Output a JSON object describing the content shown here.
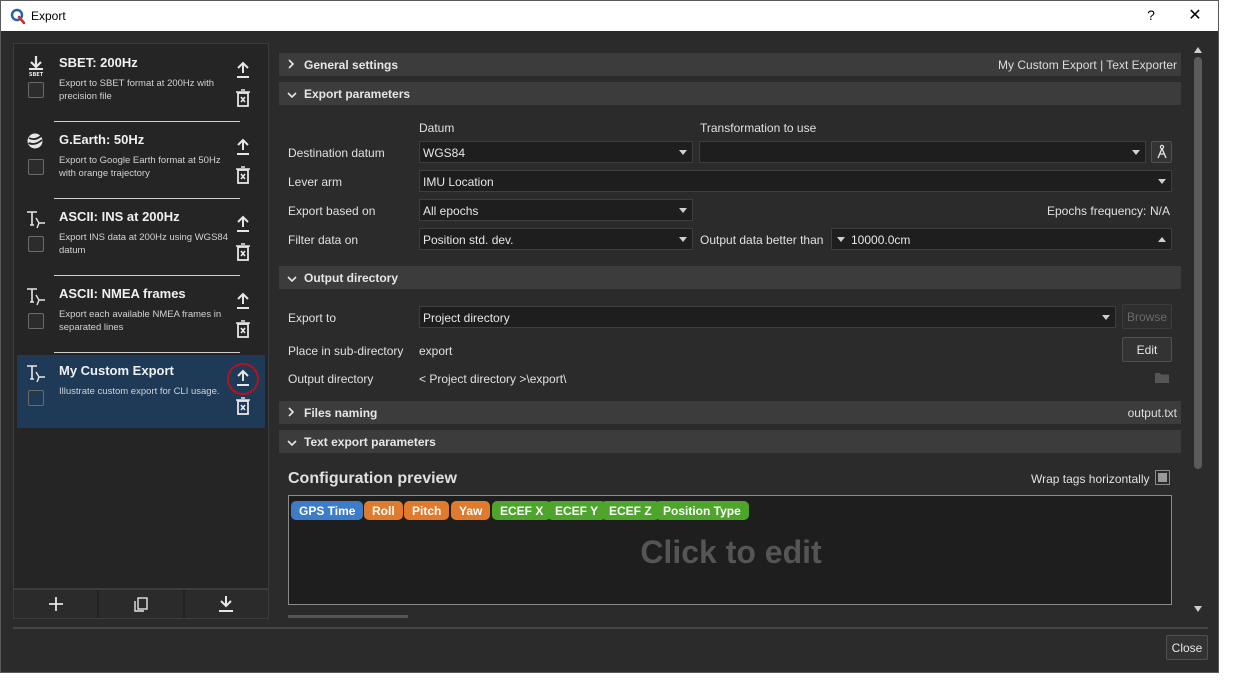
{
  "window": {
    "title": "Export",
    "help_label": "?",
    "close_label": "✕"
  },
  "exports": [
    {
      "name": "SBET: 200Hz",
      "desc": "Export to SBET format at 200Hz with precision file",
      "icon": "sbet-download-icon"
    },
    {
      "name": "G.Earth: 50Hz",
      "desc": "Export to Google Earth format at 50Hz with orange trajectory",
      "icon": "google-earth-icon"
    },
    {
      "name": "ASCII: INS at 200Hz",
      "desc": "Export INS data at 200Hz using WGS84 datum",
      "icon": "text-format-icon"
    },
    {
      "name": "ASCII: NMEA frames",
      "desc": "Export each available NMEA frames in separated lines",
      "icon": "text-format-icon"
    },
    {
      "name": "My Custom Export",
      "desc": "Illustrate custom export for CLI usage.",
      "icon": "text-format-icon",
      "selected": true
    }
  ],
  "left_toolbar": [
    "add-icon",
    "duplicate-icon",
    "import-icon"
  ],
  "sections": {
    "general": {
      "label": "General settings",
      "summary": "My Custom Export | Text Exporter"
    },
    "export_params": {
      "label": "Export parameters"
    },
    "output_dir": {
      "label": "Output directory"
    },
    "files_naming": {
      "label": "Files naming",
      "summary": "output.txt"
    },
    "text_params": {
      "label": "Text export parameters"
    }
  },
  "params": {
    "datum_header": "Datum",
    "transform_header": "Transformation to use",
    "dest_datum_label": "Destination datum",
    "dest_datum_value": "WGS84",
    "transform_value": "",
    "lever_arm_label": "Lever arm",
    "lever_arm_value": "IMU Location",
    "export_based_label": "Export based on",
    "export_based_value": "All epochs",
    "epochs_freq_label": "Epochs frequency:",
    "epochs_freq_value": "N/A",
    "filter_label": "Filter data on",
    "filter_value": "Position std. dev.",
    "output_better_label": "Output data better than",
    "output_better_value": "10000.0cm"
  },
  "output": {
    "export_to_label": "Export to",
    "export_to_value": "Project directory",
    "browse_label": "Browse",
    "subdir_label": "Place in sub-directory",
    "subdir_value": "export",
    "edit_label": "Edit",
    "outdir_label": "Output directory",
    "outdir_value": "< Project directory >\\export\\"
  },
  "preview": {
    "title": "Configuration preview",
    "wrap_label": "Wrap tags horizontally",
    "placeholder": "Click to edit",
    "tags": [
      {
        "label": "GPS Time",
        "color": "#3d7cc9"
      },
      {
        "label": "Roll",
        "color": "#e07a2c"
      },
      {
        "label": "Pitch",
        "color": "#e07a2c"
      },
      {
        "label": "Yaw",
        "color": "#e07a2c"
      },
      {
        "label": "ECEF X",
        "color": "#4ea52b"
      },
      {
        "label": "ECEF Y",
        "color": "#4ea52b"
      },
      {
        "label": "ECEF Z",
        "color": "#4ea52b"
      },
      {
        "label": "Position Type",
        "color": "#4ea52b"
      }
    ]
  },
  "footer": {
    "close_label": "Close"
  }
}
